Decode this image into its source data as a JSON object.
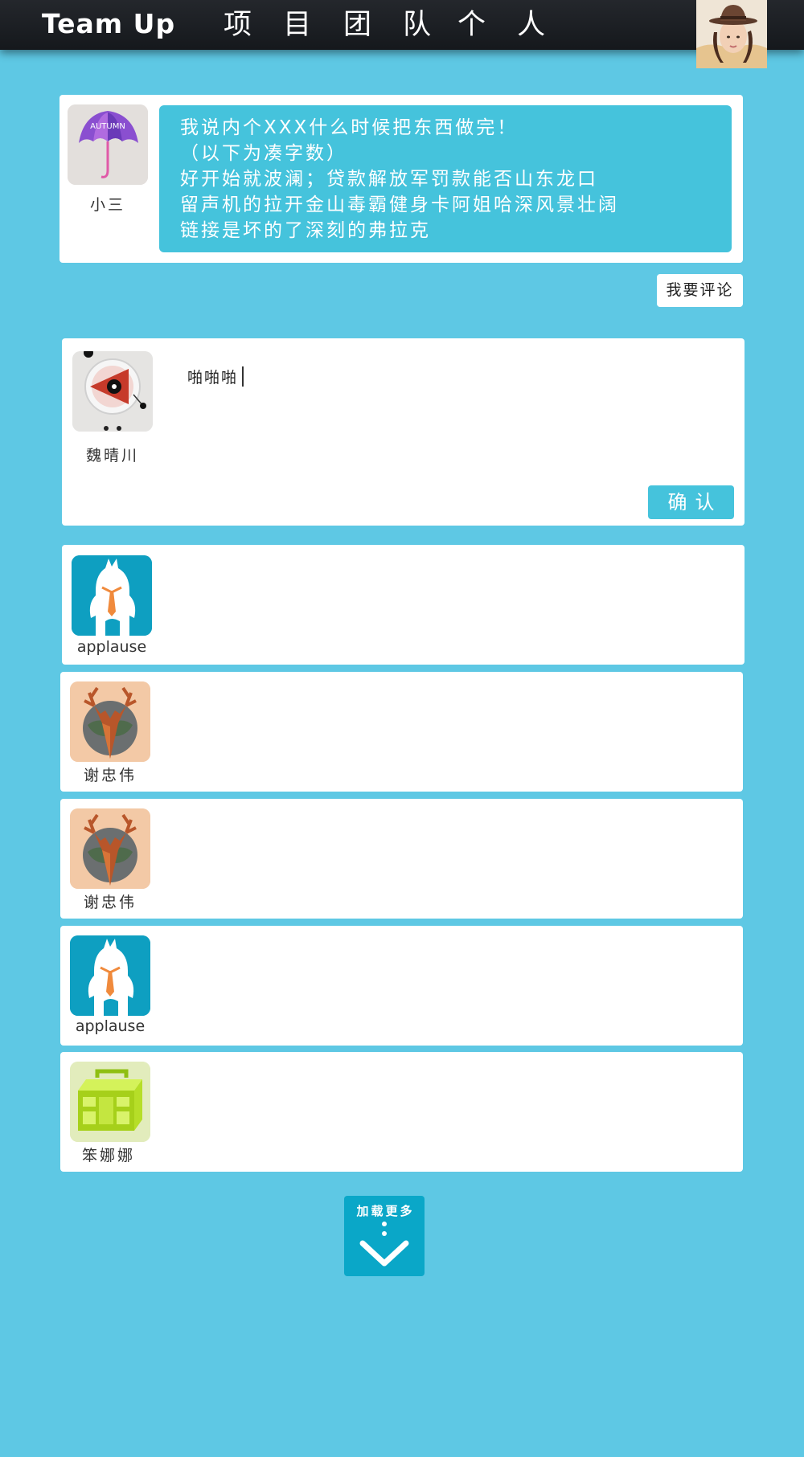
{
  "header": {
    "logo": "Team Up",
    "nav": [
      "项 目",
      "团 队",
      "个 人"
    ]
  },
  "post": {
    "author": "小三",
    "author_avatar_icon": "autumn-umbrella-avatar",
    "avatar_text": "AUTUMN",
    "lines": [
      "我说内个XXX什么时候把东西做完！",
      "（以下为凑字数）",
      "好开始就波澜；贷款解放军罚款能否山东龙口",
      "留声机的拉开金山毒霸健身卡阿姐哈深风景壮阔",
      "链接是坏的了深刻的弗拉克"
    ]
  },
  "comment_toggle_label": "我要评论",
  "compose": {
    "user": "魏晴川",
    "avatar_icon": "triangle-eye-avatar",
    "input_value": "啪啪啪",
    "confirm_label": "确认"
  },
  "comments": [
    {
      "user": "applause",
      "avatar_icon": "white-monster-tie-avatar"
    },
    {
      "user": "谢忠伟",
      "avatar_icon": "deer-avatar"
    },
    {
      "user": "谢忠伟",
      "avatar_icon": "deer-avatar"
    },
    {
      "user": "applause",
      "avatar_icon": "white-monster-tie-avatar"
    },
    {
      "user": "笨娜娜",
      "avatar_icon": "boombox-avatar"
    }
  ],
  "load_more": {
    "label": "加载更多",
    "icon": "chevron-down-icon"
  },
  "colors": {
    "page_background": "#5ec8e4",
    "accent": "#45c3dc",
    "top_bar": "#1c1f23",
    "load_more": "#0aa7c8"
  }
}
